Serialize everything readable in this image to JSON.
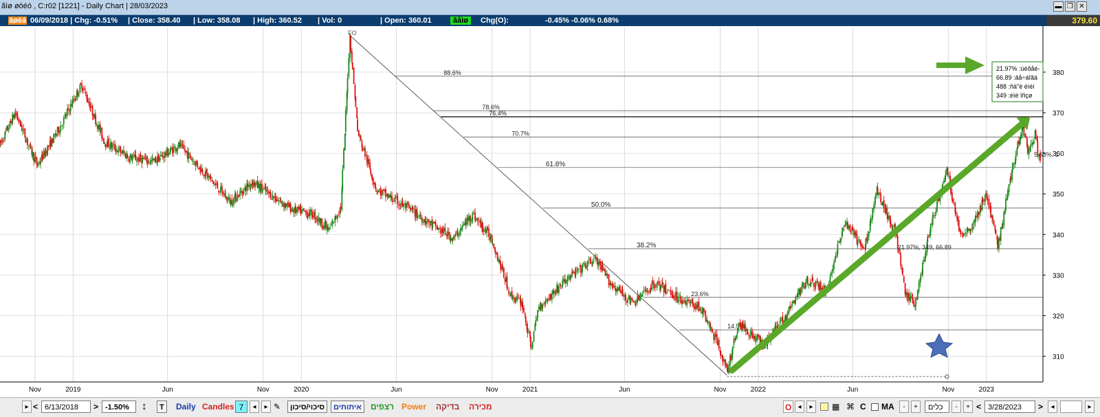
{
  "window": {
    "title": "ãìø øöéó , C:r02  [1221]  - Daily Chart | 28/03/2023",
    "controls": [
      "▬",
      "❐",
      "✕"
    ]
  },
  "infobar": {
    "symbol": "äøéá",
    "date_chg": "06/09/2018 | Chg: -0.51%",
    "close": "| Close: 358.40",
    "low": "| Low: 358.08",
    "high": "| High: 360.52",
    "vol": "| Vol: 0",
    "open": "| Open: 360.01",
    "status": "ãåìø",
    "chg_o_label": "Chg(O):",
    "chg_o_values": "-0.45% -0.06% 0.68%",
    "last_price": "379.60"
  },
  "chart_data": {
    "type": "candlestick",
    "ylim": [
      304,
      391
    ],
    "y_ticks": [
      "310",
      "320",
      "330",
      "340",
      "350",
      "360",
      "370",
      "380"
    ],
    "x_ticks": [
      "Nov",
      "2019",
      "Jun",
      "Nov",
      "2020",
      "Jun",
      "Nov",
      "2021",
      "Jun",
      "Nov",
      "2022",
      "Jun",
      "Nov",
      "2023"
    ],
    "x_tick_dates": [
      "2018-11-01",
      "2019-01-01",
      "2019-06-01",
      "2019-11-01",
      "2020-01-01",
      "2020-06-01",
      "2020-11-01",
      "2021-01-01",
      "2021-06-01",
      "2021-11-01",
      "2022-01-01",
      "2022-06-01",
      "2022-11-01",
      "2023-01-01"
    ],
    "x_range": [
      "2018-09-06",
      "2023-03-28"
    ],
    "price_path": [
      [
        "2018-09-06",
        362
      ],
      [
        "2018-10-01",
        370
      ],
      [
        "2018-11-05",
        357
      ],
      [
        "2018-12-10",
        366
      ],
      [
        "2019-01-15",
        377
      ],
      [
        "2019-02-20",
        363
      ],
      [
        "2019-04-01",
        359
      ],
      [
        "2019-05-10",
        358
      ],
      [
        "2019-06-20",
        362
      ],
      [
        "2019-08-01",
        355
      ],
      [
        "2019-09-10",
        348
      ],
      [
        "2019-10-15",
        353
      ],
      [
        "2019-11-20",
        349
      ],
      [
        "2019-12-20",
        346
      ],
      [
        "2020-01-20",
        345
      ],
      [
        "2020-02-15",
        341
      ],
      [
        "2020-03-05",
        347
      ],
      [
        "2020-03-19",
        389
      ],
      [
        "2020-04-01",
        365
      ],
      [
        "2020-05-01",
        351
      ],
      [
        "2020-06-15",
        347
      ],
      [
        "2020-08-01",
        342
      ],
      [
        "2020-09-01",
        339
      ],
      [
        "2020-10-01",
        345
      ],
      [
        "2020-11-01",
        339
      ],
      [
        "2020-12-01",
        325
      ],
      [
        "2020-12-20",
        323
      ],
      [
        "2021-01-03",
        312
      ],
      [
        "2021-01-15",
        322
      ],
      [
        "2021-03-01",
        329
      ],
      [
        "2021-04-15",
        334
      ],
      [
        "2021-05-10",
        328
      ],
      [
        "2021-06-15",
        323
      ],
      [
        "2021-07-20",
        328
      ],
      [
        "2021-09-01",
        324
      ],
      [
        "2021-10-01",
        322
      ],
      [
        "2021-11-01",
        312
      ],
      [
        "2021-11-12",
        306
      ],
      [
        "2021-12-01",
        318
      ],
      [
        "2022-01-10",
        313
      ],
      [
        "2022-02-15",
        320
      ],
      [
        "2022-03-20",
        329
      ],
      [
        "2022-04-20",
        326
      ],
      [
        "2022-05-20",
        343
      ],
      [
        "2022-06-20",
        336
      ],
      [
        "2022-07-10",
        351
      ],
      [
        "2022-08-10",
        340
      ],
      [
        "2022-08-25",
        325
      ],
      [
        "2022-09-10",
        323
      ],
      [
        "2022-10-01",
        340
      ],
      [
        "2022-10-30",
        356
      ],
      [
        "2022-11-20",
        340
      ],
      [
        "2022-12-10",
        342
      ],
      [
        "2023-01-01",
        350
      ],
      [
        "2023-01-20",
        337
      ],
      [
        "2023-02-10",
        355
      ],
      [
        "2023-02-28",
        367
      ],
      [
        "2023-03-10",
        360
      ],
      [
        "2023-03-20",
        365
      ],
      [
        "2023-03-28",
        358
      ]
    ],
    "fibonacci": [
      {
        "label": "88.6%",
        "value": 379
      },
      {
        "label": "78.6%",
        "value": 370.5
      },
      {
        "label": "76.4%",
        "value": 369
      },
      {
        "label": "70.7%",
        "value": 364
      },
      {
        "label": "61.8%",
        "value": 356.5
      },
      {
        "label": "50.0%",
        "value": 346.5
      },
      {
        "label": "38.2%",
        "value": 336.5
      },
      {
        "label": "23.6%",
        "value": 324.5
      },
      {
        "label": "14.5%",
        "value": 316.5
      }
    ],
    "fib_anchor_label": "FO",
    "annotations": {
      "trend_label": "21.97%, 349, 66.89",
      "pct_label": "5.63%, 1",
      "info_box": [
        "21.97% :úéðåé-",
        "66.89 :ãå÷áîãä",
        "488 :ñä\"ë éìéí",
        "349 :éìé îñçø"
      ]
    }
  },
  "toolbar": {
    "date_left": "6/13/2018",
    "pct": "-1.50%",
    "t_label": "T",
    "daily": "Daily",
    "candles": "Candles",
    "seven": "7",
    "siyuv": "סיכוי/סיכון",
    "itutim": "איתותים",
    "retzafim": "רצפים",
    "power": "Power",
    "bdika": "בדיקה",
    "mechira": "מכירה",
    "o_label": "O",
    "c_label": "C",
    "ma": "MA",
    "klim": "כלים",
    "date_right": "3/28/2023",
    "colors": {
      "daily": "#1a3aa8",
      "candles": "#d42020",
      "itutim": "#1a3aa8",
      "retzafim": "#1f9a1f",
      "power": "#f07c14",
      "bdika": "#a52a2a",
      "mechira": "#d42020",
      "up_candle": "#1a8a1a",
      "down_candle": "#e01010",
      "arrow": "#5aa82a"
    }
  }
}
